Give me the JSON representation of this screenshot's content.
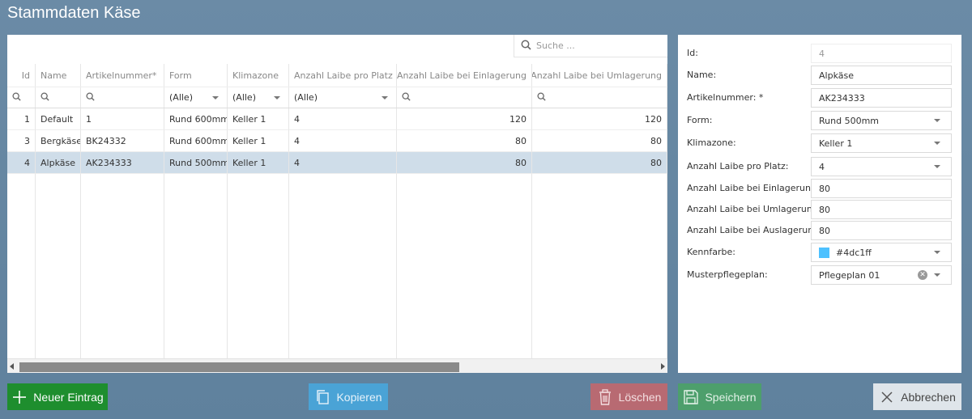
{
  "window": {
    "title": "Stammdaten Käse"
  },
  "search": {
    "placeholder": "Suche ..."
  },
  "grid": {
    "columns": [
      "Id",
      "Name",
      "Artikelnummer*",
      "Form",
      "Klimazone",
      "Anzahl Laibe pro Platz",
      "Anzahl Laibe bei Einlagerung",
      "Anzahl Laibe bei Umlagerung"
    ],
    "filters": {
      "form": "(Alle)",
      "klimazone": "(Alle)",
      "laibe_pro_platz": "(Alle)"
    },
    "rows": [
      {
        "id": "1",
        "name": "Default",
        "artikelnummer": "1",
        "form": "Rund 600mm",
        "klimazone": "Keller 1",
        "laibe_pro_platz": "4",
        "einlagerung": "120",
        "umlagerung": "120"
      },
      {
        "id": "3",
        "name": "Bergkäse",
        "artikelnummer": "BK24332",
        "form": "Rund 600mm",
        "klimazone": "Keller 1",
        "laibe_pro_platz": "4",
        "einlagerung": "80",
        "umlagerung": "80"
      },
      {
        "id": "4",
        "name": "Alpkäse",
        "artikelnummer": "AK234333",
        "form": "Rund 500mm",
        "klimazone": "Keller 1",
        "laibe_pro_platz": "4",
        "einlagerung": "80",
        "umlagerung": "80"
      }
    ],
    "selected_row_index": 2
  },
  "form": {
    "id": {
      "label": "Id:",
      "value": "4"
    },
    "name": {
      "label": "Name:",
      "value": "Alpkäse"
    },
    "artikelnummer": {
      "label": "Artikelnummer: *",
      "value": "AK234333"
    },
    "form": {
      "label": "Form:",
      "value": "Rund 500mm"
    },
    "klimazone": {
      "label": "Klimazone:",
      "value": "Keller 1"
    },
    "laibe_pro_platz": {
      "label": "Anzahl Laibe pro Platz:",
      "value": "4"
    },
    "einlagerung": {
      "label": "Anzahl Laibe bei Einlagerung:",
      "value": "80"
    },
    "umlagerung": {
      "label": "Anzahl Laibe bei Umlagerung:",
      "value": "80"
    },
    "auslagerung": {
      "label": "Anzahl Laibe bei Auslagerung:",
      "value": "80"
    },
    "kennfarbe": {
      "label": "Kennfarbe:",
      "value": "#4dc1ff",
      "color": "#4dc1ff"
    },
    "musterpflegeplan": {
      "label": "Musterpflegeplan:",
      "value": "Pflegeplan 01"
    }
  },
  "buttons": {
    "new": "Neuer Eintrag",
    "copy": "Kopieren",
    "delete": "Löschen",
    "save": "Speichern",
    "cancel": "Abbrechen"
  },
  "colors": {
    "new_button": "#1e8e2e",
    "copy_button": "#4aa3d6",
    "delete_button": "#b86a72",
    "save_button": "#4d9f6c",
    "selected_row": "#cfdde9"
  }
}
